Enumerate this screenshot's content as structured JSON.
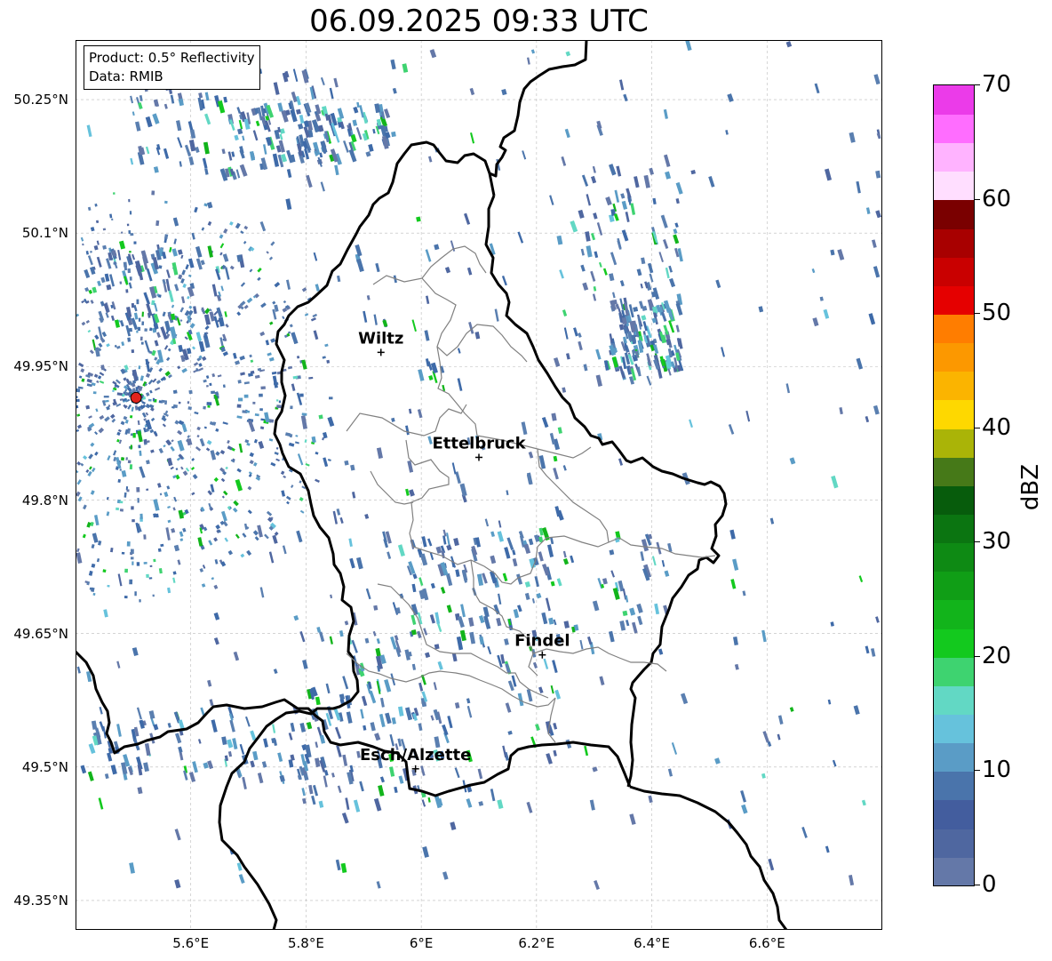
{
  "title": "06.09.2025 09:33 UTC",
  "info_box": {
    "product": "Product: 0.5° Reflectivity",
    "data_source": "Data: RMIB"
  },
  "latitude_labels": [
    "50.25°N",
    "50.1°N",
    "49.95°N",
    "49.8°N",
    "49.65°N",
    "49.5°N",
    "49.35°N"
  ],
  "longitude_labels": [
    "5.6°E",
    "5.8°E",
    "6°E",
    "6.2°E",
    "6.4°E",
    "6.6°E"
  ],
  "cities": [
    {
      "name": "Wiltz",
      "lon": 5.93,
      "lat": 49.966
    },
    {
      "name": "Ettelbruck",
      "lon": 6.1,
      "lat": 49.848
    },
    {
      "name": "Findel",
      "lon": 6.21,
      "lat": 49.626
    },
    {
      "name": "Esch/Alzette",
      "lon": 5.99,
      "lat": 49.498
    }
  ],
  "radar_site": {
    "lon": 5.505,
    "lat": 49.915
  },
  "colorbar": {
    "unit": "dBZ",
    "min": 0,
    "max": 70,
    "tick_labels": [
      "0",
      "10",
      "20",
      "30",
      "40",
      "50",
      "60",
      "70"
    ],
    "colors": [
      "#6478a8",
      "#4f67a0",
      "#435d9e",
      "#4a74ab",
      "#5a9cc6",
      "#66c2dc",
      "#62d8c4",
      "#3ed370",
      "#13c91e",
      "#12b41b",
      "#109e16",
      "#0e8a14",
      "#0b7511",
      "#075c0c",
      "#467918",
      "#aab407",
      "#fed800",
      "#fbb400",
      "#fc9800",
      "#ff7d00",
      "#e50000",
      "#c90000",
      "#a80000",
      "#7a0000",
      "#ffdeff",
      "#ffb3ff",
      "#ff6dff",
      "#eb3be9"
    ]
  },
  "map_extent": {
    "lon_min": 5.4,
    "lon_max": 6.8,
    "lat_min": 49.317,
    "lat_max": 50.317
  }
}
